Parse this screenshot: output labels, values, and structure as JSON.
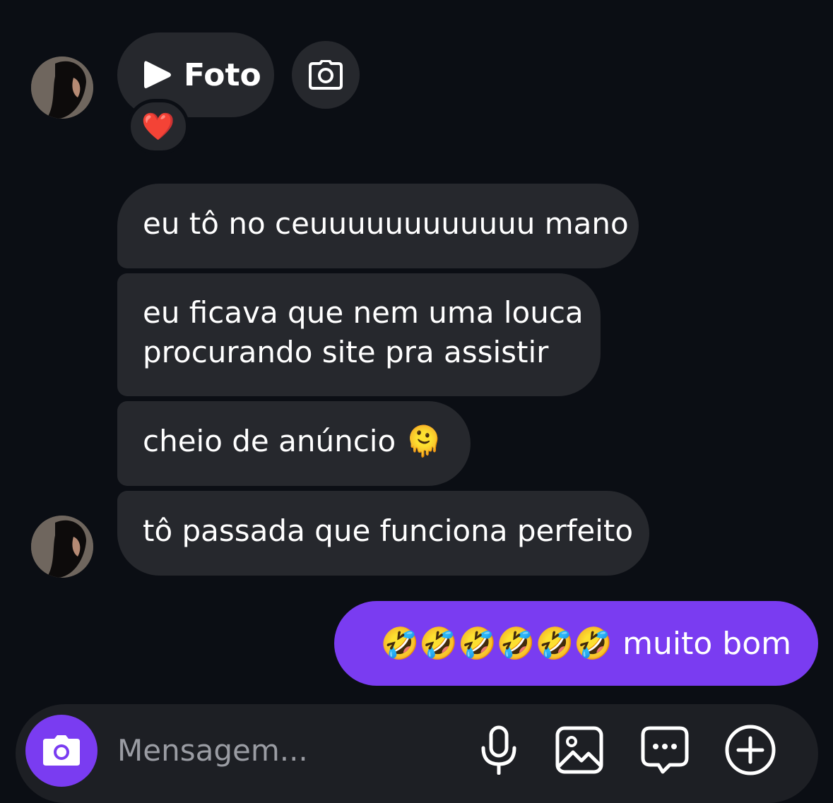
{
  "conversation": {
    "photo_message": {
      "label": "Foto",
      "reaction": "❤️"
    },
    "received": [
      {
        "text": "eu tô no ceuuuuuuuuuuuu mano"
      },
      {
        "line1": "eu ficava que nem uma louca",
        "line2": "procurando site pra assistir"
      },
      {
        "text": "cheio de anúncio 🫠"
      },
      {
        "text": "tô passada que funciona perfeito"
      }
    ],
    "sent": [
      {
        "text": "🤣🤣🤣🤣🤣🤣 muito bom"
      }
    ]
  },
  "composer": {
    "placeholder": "Mensagem..."
  },
  "colors": {
    "background": "#0b0e14",
    "received_bubble": "#26282d",
    "sent_bubble": "#7a3cf1",
    "composer": "#1d1f24",
    "placeholder": "#9a9ca3"
  },
  "icons": [
    "play-icon",
    "camera-icon",
    "microphone-icon",
    "gallery-icon",
    "sticker-icon",
    "plus-icon"
  ]
}
